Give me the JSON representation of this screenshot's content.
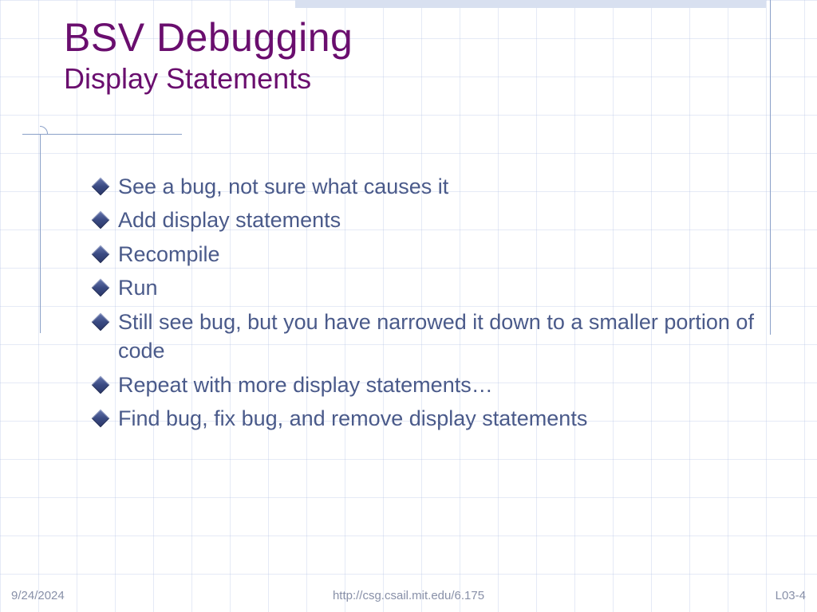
{
  "title": {
    "main": "BSV Debugging",
    "sub": "Display Statements"
  },
  "bullets": [
    "See a bug, not sure what causes it",
    "Add display statements",
    "Recompile",
    "Run",
    "Still see bug, but you have narrowed it down to a smaller portion of code",
    "Repeat with more display statements…",
    "Find bug, fix bug, and remove display statements"
  ],
  "footer": {
    "date": "9/24/2024",
    "url": "http://csg.csail.mit.edu/6.175",
    "page": "L03-4"
  }
}
